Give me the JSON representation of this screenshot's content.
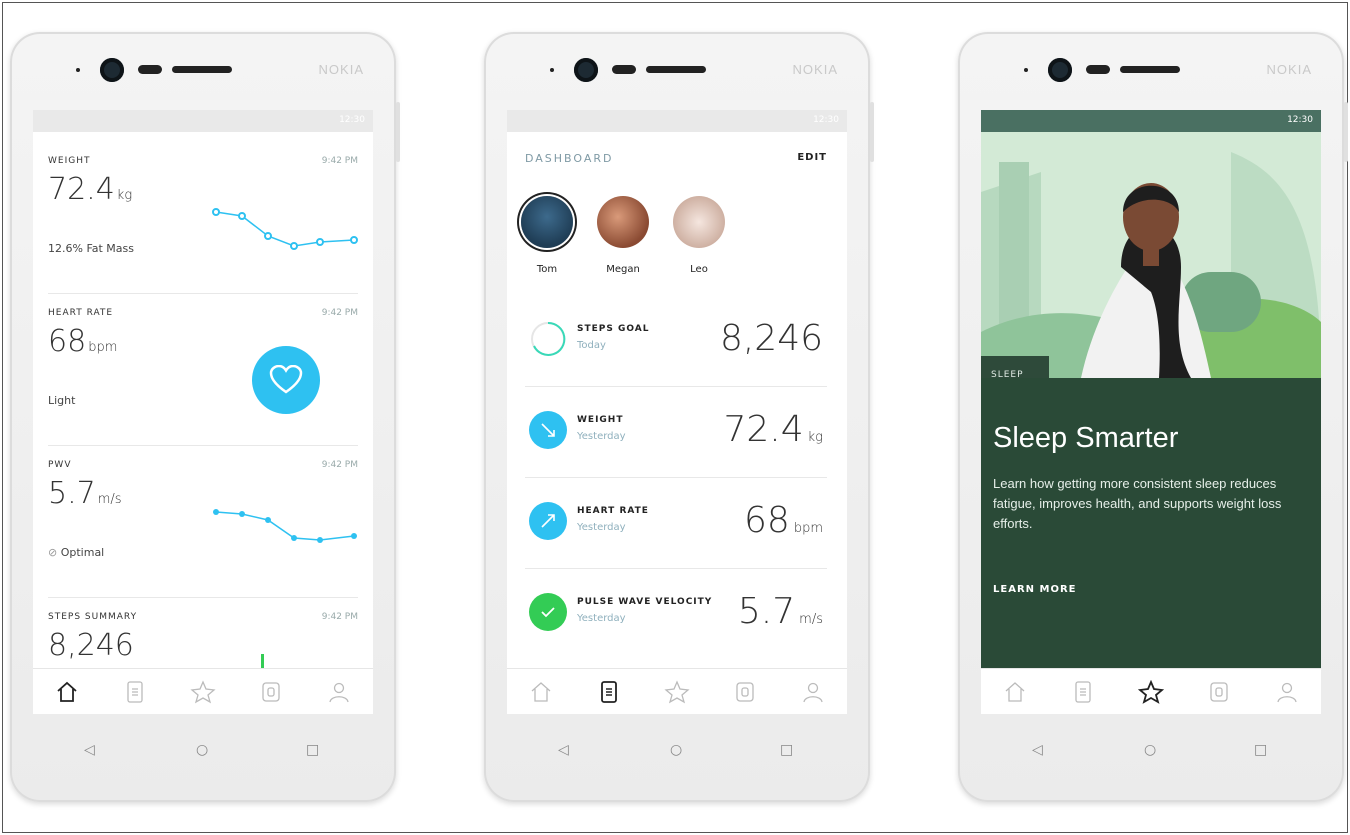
{
  "brand": "NOKIA",
  "status_time": "12:30",
  "phone1": {
    "cards": [
      {
        "label": "WEIGHT",
        "time": "9:42 PM",
        "value": "72.4",
        "unit": "kg",
        "sub": "12.6% Fat Mass"
      },
      {
        "label": "HEART RATE",
        "time": "9:42 PM",
        "value": "68",
        "unit": "bpm",
        "sub": "Light"
      },
      {
        "label": "PWV",
        "time": "9:42 PM",
        "value": "5.7",
        "unit": "m/s",
        "sub": "Optimal"
      },
      {
        "label": "STEPS SUMMARY",
        "time": "9:42 PM",
        "value": "8,246",
        "unit": ""
      }
    ],
    "nav_active": "home"
  },
  "phone2": {
    "title": "DASHBOARD",
    "edit": "EDIT",
    "people": [
      "Tom",
      "Megan",
      "Leo"
    ],
    "rows": [
      {
        "label": "STEPS GOAL",
        "day": "Today",
        "value": "8,246",
        "unit": ""
      },
      {
        "label": "WEIGHT",
        "day": "Yesterday",
        "value": "72.4",
        "unit": "kg"
      },
      {
        "label": "HEART RATE",
        "day": "Yesterday",
        "value": "68",
        "unit": "bpm"
      },
      {
        "label": "PULSE WAVE VELOCITY",
        "day": "Yesterday",
        "value": "5.7",
        "unit": "m/s"
      }
    ],
    "nav_active": "timeline"
  },
  "phone3": {
    "tag": "SLEEP",
    "title": "Sleep Smarter",
    "body": "Learn how getting more consistent sleep reduces fatigue, improves health, and supports weight loss efforts.",
    "cta": "LEARN MORE",
    "nav_active": "programs"
  },
  "nav_icons": [
    "home-icon",
    "timeline-icon",
    "star-icon",
    "device-icon",
    "profile-icon"
  ],
  "colors": {
    "accent_blue": "#2ec1f1",
    "green": "#33cc55",
    "dark_green": "#2a4a37"
  }
}
